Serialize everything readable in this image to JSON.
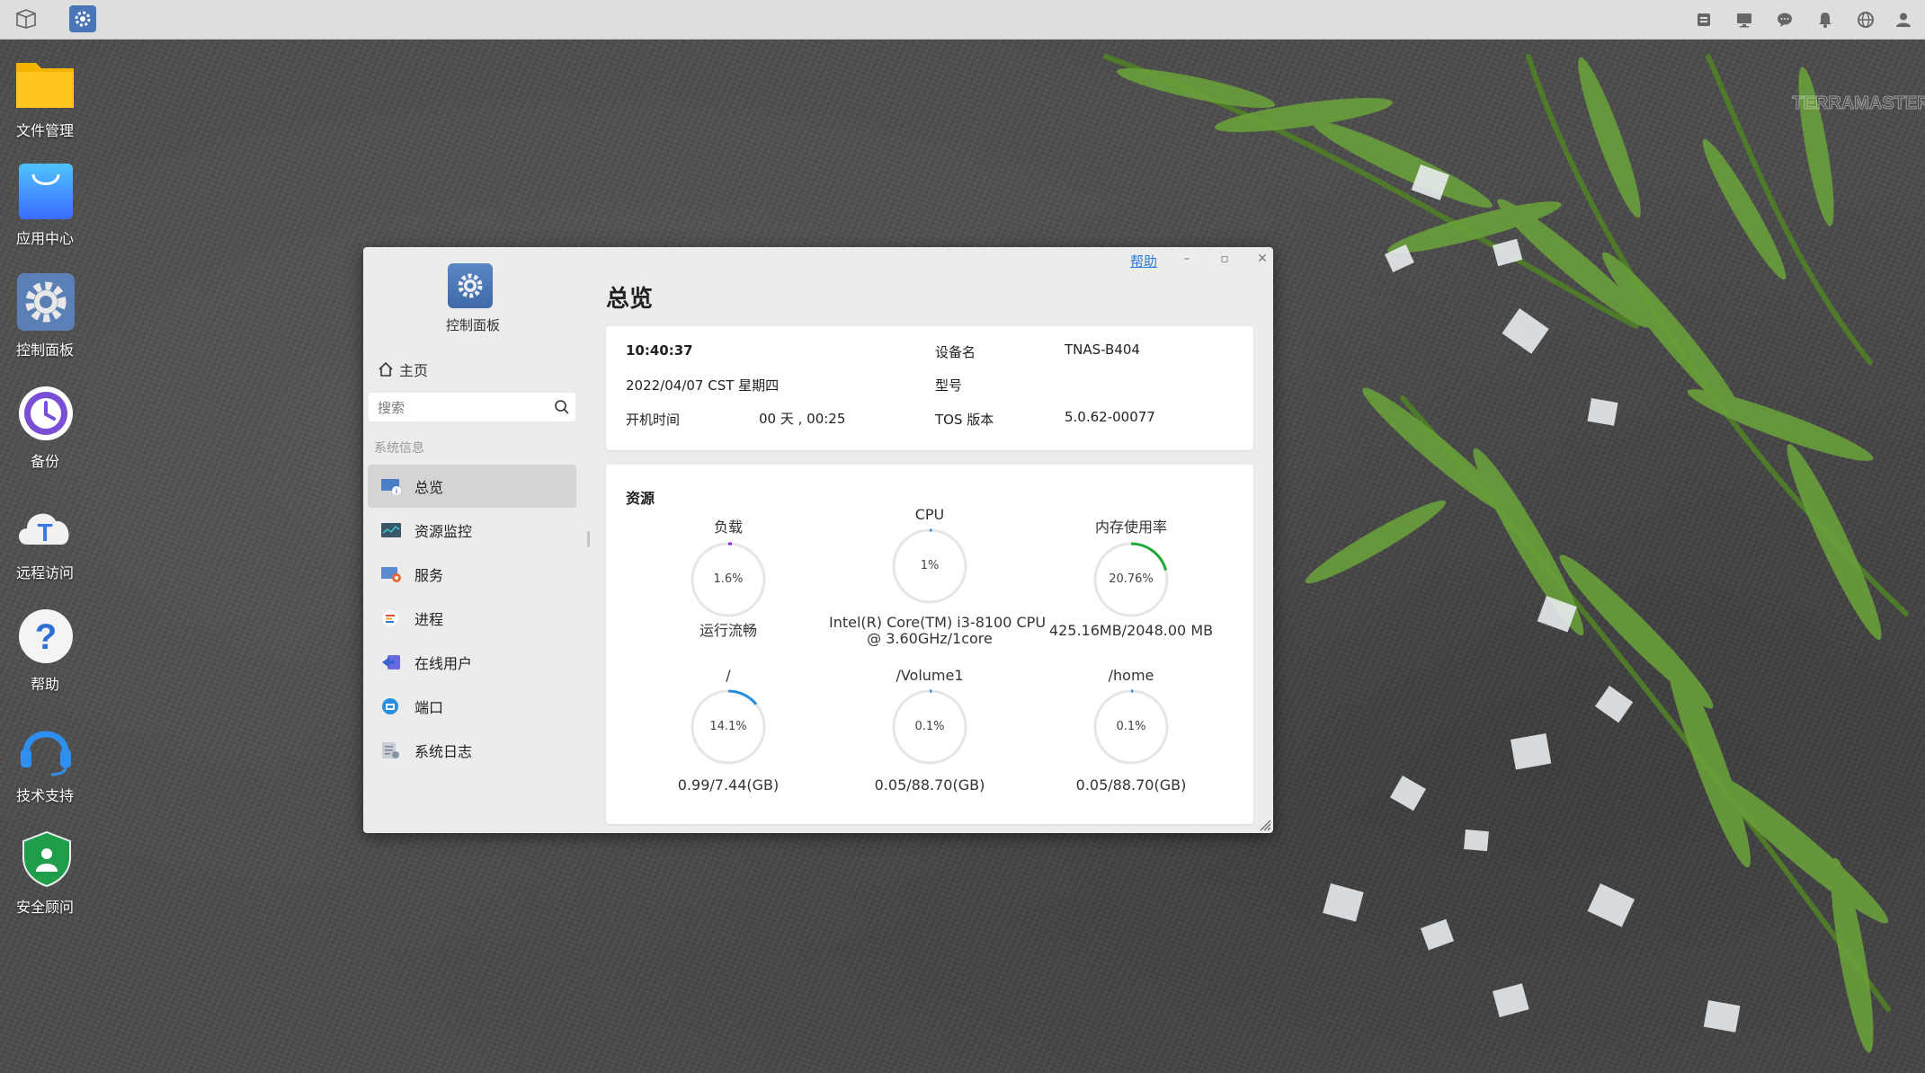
{
  "taskbar": {
    "left_icons": [
      "windows-icon",
      "control-panel-icon"
    ],
    "right_icons": [
      "disk-icon",
      "monitor-icon",
      "chat-icon",
      "bell-icon",
      "globe-icon",
      "user-icon"
    ]
  },
  "desktop": {
    "icons": [
      {
        "label": "文件管理",
        "icon": "folder-icon"
      },
      {
        "label": "应用中心",
        "icon": "app-store-icon"
      },
      {
        "label": "控制面板",
        "icon": "gear-icon"
      },
      {
        "label": "备份",
        "icon": "backup-clock-icon"
      },
      {
        "label": "远程访问",
        "icon": "cloud-t-icon"
      },
      {
        "label": "帮助",
        "icon": "question-icon"
      },
      {
        "label": "技术支持",
        "icon": "headset-icon"
      },
      {
        "label": "安全顾问",
        "icon": "shield-icon"
      }
    ],
    "watermark": "TERRAMASTER"
  },
  "window": {
    "help_label": "帮助",
    "minimize_glyph": "–",
    "maximize_glyph": "▫",
    "close_glyph": "✕",
    "sidebar": {
      "title": "控制面板",
      "home_label": "主页",
      "search_placeholder": "搜索",
      "section_label": "系统信息",
      "items": [
        {
          "label": "总览",
          "icon": "overview-icon",
          "active": true
        },
        {
          "label": "资源监控",
          "icon": "resource-monitor-icon",
          "active": false
        },
        {
          "label": "服务",
          "icon": "service-icon",
          "active": false
        },
        {
          "label": "进程",
          "icon": "process-icon",
          "active": false
        },
        {
          "label": "在线用户",
          "icon": "online-users-icon",
          "active": false
        },
        {
          "label": "端口",
          "icon": "port-icon",
          "active": false
        },
        {
          "label": "系统日志",
          "icon": "system-log-icon",
          "active": false
        }
      ]
    },
    "main": {
      "title": "总览",
      "info": {
        "time": "10:40:37",
        "date": "2022/04/07 CST 星期四",
        "uptime_label": "开机时间",
        "uptime_value": "00 天 , 00:25",
        "device_name_label": "设备名",
        "device_name_value": "TNAS-B404",
        "model_label": "型号",
        "model_value": "",
        "tos_label": "TOS 版本",
        "tos_value": "5.0.62-00077"
      },
      "resources": {
        "title": "资源",
        "gauges": [
          {
            "label": "负载",
            "percent_text": "1.6%",
            "fraction": 0.016,
            "sub": "运行流畅",
            "sub2": "",
            "color": "#8a2be2"
          },
          {
            "label": "CPU",
            "percent_text": "1%",
            "fraction": 0.01,
            "sub": "Intel(R) Core(TM) i3-8100 CPU",
            "sub2": "@ 3.60GHz/1core",
            "color": "#2a8ee0"
          },
          {
            "label": "内存使用率",
            "percent_text": "20.76%",
            "fraction": 0.2076,
            "sub": "425.16MB/2048.00 MB",
            "sub2": "",
            "color": "#22a83a"
          },
          {
            "label": "/",
            "percent_text": "14.1%",
            "fraction": 0.141,
            "sub": "0.99/7.44(GB)",
            "sub2": "",
            "color": "#2a8ee0"
          },
          {
            "label": "/Volume1",
            "percent_text": "0.1%",
            "fraction": 0.001,
            "sub": "0.05/88.70(GB)",
            "sub2": "",
            "color": "#2a8ee0"
          },
          {
            "label": "/home",
            "percent_text": "0.1%",
            "fraction": 0.001,
            "sub": "0.05/88.70(GB)",
            "sub2": "",
            "color": "#2a8ee0"
          }
        ]
      }
    }
  }
}
